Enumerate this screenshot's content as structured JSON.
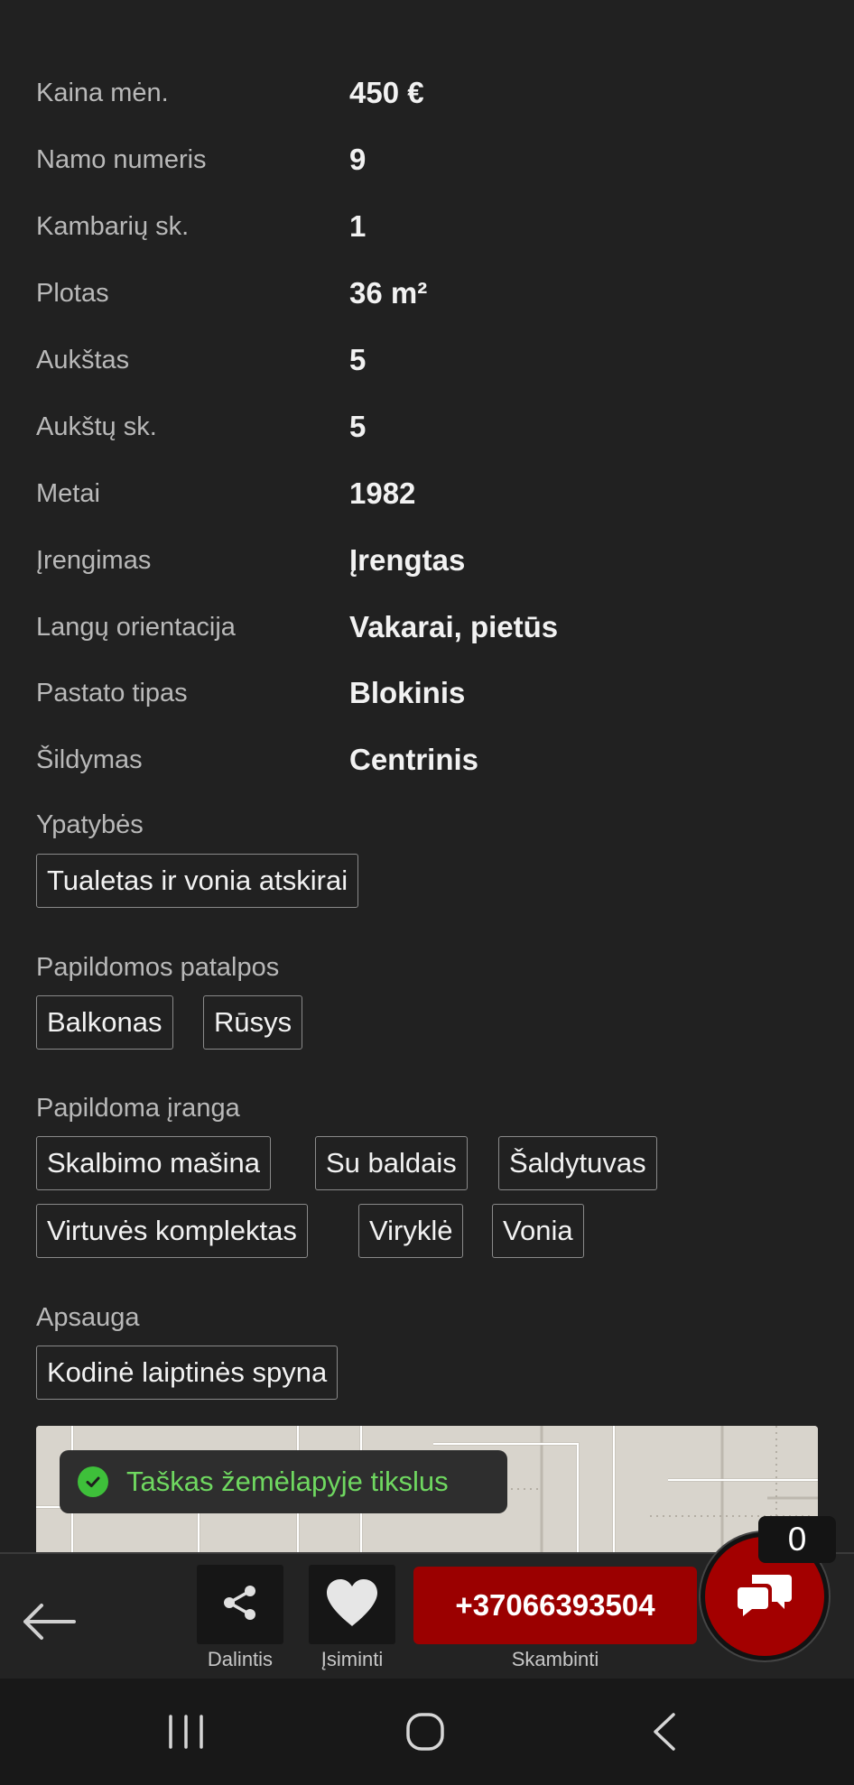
{
  "details": [
    {
      "label": "Kaina mėn.",
      "value": "450 €"
    },
    {
      "label": "Namo numeris",
      "value": "9"
    },
    {
      "label": "Kambarių sk.",
      "value": "1"
    },
    {
      "label": "Plotas",
      "value": "36 m²"
    },
    {
      "label": "Aukštas",
      "value": "5"
    },
    {
      "label": "Aukštų sk.",
      "value": "5"
    },
    {
      "label": "Metai",
      "value": "1982"
    },
    {
      "label": "Įrengimas",
      "value": "Įrengtas"
    },
    {
      "label": "Langų orientacija",
      "value": "Vakarai, pietūs"
    },
    {
      "label": "Pastato tipas",
      "value": "Blokinis"
    },
    {
      "label": "Šildymas",
      "value": "Centrinis"
    }
  ],
  "sections": {
    "features": {
      "title": "Ypatybės",
      "chips": [
        "Tualetas ir vonia atskirai"
      ]
    },
    "extra_rooms": {
      "title": "Papildomos patalpos",
      "chips": [
        "Balkonas",
        "Rūsys"
      ]
    },
    "equipment": {
      "title": "Papildoma įranga",
      "chips": [
        "Skalbimo mašina",
        "Su baldais",
        "Šaldytuvas",
        "Virtuvės komplektas",
        "Viryklė",
        "Vonia"
      ]
    },
    "security": {
      "title": "Apsauga",
      "chips": [
        "Kodinė laiptinės spyna"
      ]
    }
  },
  "map": {
    "toast_text": "Taškas žemėlapyje tikslus"
  },
  "actions": {
    "share_label": "Dalintis",
    "save_label": "Įsiminti",
    "call_number": "+37066393504",
    "call_label": "Skambinti",
    "chat_count": "0"
  },
  "icons": [
    "back-arrow-icon",
    "share-icon",
    "heart-icon",
    "chat-icon",
    "check-icon",
    "recent-apps-icon",
    "home-icon",
    "nav-back-icon"
  ],
  "colors": {
    "background": "#212121",
    "accent_red": "#9b0000",
    "toast_green": "#6fd860"
  }
}
